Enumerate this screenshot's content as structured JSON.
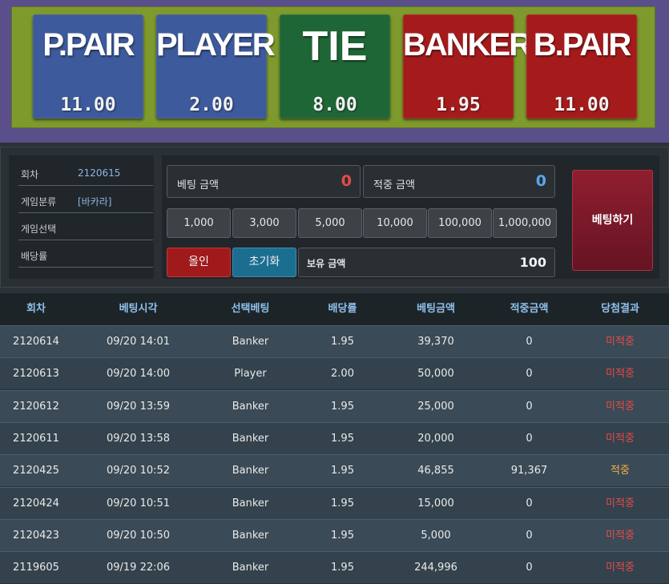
{
  "bet_board": {
    "tiles": [
      {
        "label": "P.PAIR",
        "odds": "11.00"
      },
      {
        "label": "PLAYER",
        "odds": "2.00"
      },
      {
        "label": "TIE",
        "odds": "8.00"
      },
      {
        "label": "BANKER",
        "odds": "1.95"
      },
      {
        "label": "B.PAIR",
        "odds": "11.00"
      }
    ]
  },
  "info": {
    "round_label": "회차",
    "round_value": "2120615",
    "category_label": "게임분류",
    "category_value": "[바카라]",
    "selection_label": "게임선택",
    "selection_value": "",
    "odds_label": "배당률",
    "odds_value": ""
  },
  "bet_panel": {
    "bet_amount_label": "베팅 금액",
    "bet_amount_value": "0",
    "hit_amount_label": "적중 금액",
    "hit_amount_value": "0",
    "chips": [
      "1,000",
      "3,000",
      "5,000",
      "10,000",
      "100,000",
      "1,000,000"
    ],
    "all_in_label": "올인",
    "reset_label": "초기화",
    "holding_label": "보유 금액",
    "holding_value": "100",
    "submit_label": "베팅하기"
  },
  "history": {
    "headers": [
      "회차",
      "베팅시각",
      "선택베팅",
      "배당률",
      "베팅금액",
      "적중금액",
      "당첨결과"
    ],
    "rows": [
      [
        "2120614",
        "09/20 14:01",
        "Banker",
        "1.95",
        "39,370",
        "0",
        "미적중"
      ],
      [
        "2120613",
        "09/20 14:00",
        "Player",
        "2.00",
        "50,000",
        "0",
        "미적중"
      ],
      [
        "2120612",
        "09/20 13:59",
        "Banker",
        "1.95",
        "25,000",
        "0",
        "미적중"
      ],
      [
        "2120611",
        "09/20 13:58",
        "Banker",
        "1.95",
        "20,000",
        "0",
        "미적중"
      ],
      [
        "2120425",
        "09/20 10:52",
        "Banker",
        "1.95",
        "46,855",
        "91,367",
        "적중"
      ],
      [
        "2120424",
        "09/20 10:51",
        "Banker",
        "1.95",
        "15,000",
        "0",
        "미적중"
      ],
      [
        "2120423",
        "09/20 10:50",
        "Banker",
        "1.95",
        "5,000",
        "0",
        "미적중"
      ],
      [
        "2119605",
        "09/19 22:06",
        "Banker",
        "1.95",
        "244,996",
        "0",
        "미적중"
      ]
    ]
  },
  "colors": {
    "board_outer": "#5a4f8a",
    "board_inner": "#7f9a2c",
    "tile_blue": "#3d5a9c",
    "tile_green": "#1f6636",
    "tile_red": "#a51b1c",
    "bet_amount_color": "#e84a4a",
    "hit_amount_color": "#5aa7ef",
    "result_lose": "#e84a4a",
    "result_win": "#f0b24a"
  }
}
